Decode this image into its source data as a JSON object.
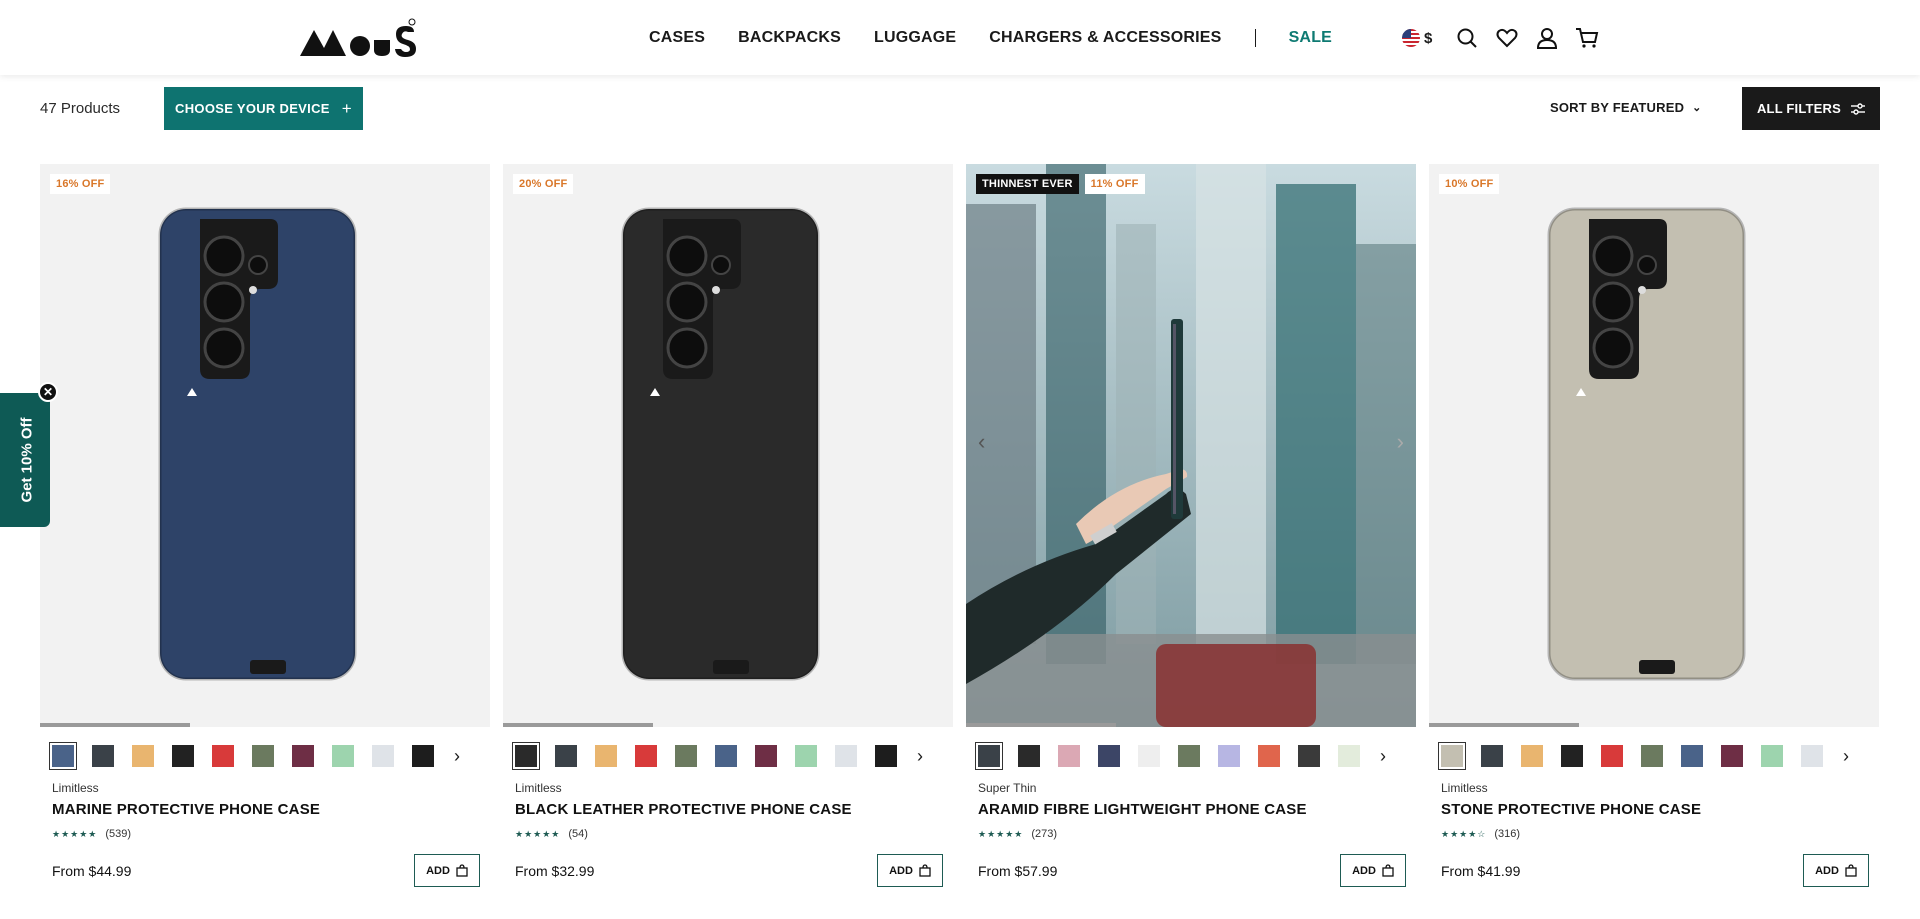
{
  "header": {
    "logo_text": "MOUS",
    "nav": [
      "CASES",
      "BACKPACKS",
      "LUGGAGE",
      "CHARGERS & ACCESSORIES"
    ],
    "sale_label": "SALE",
    "currency": "$",
    "icons": [
      "search-icon",
      "heart-icon",
      "account-icon",
      "cart-icon"
    ]
  },
  "toolbar": {
    "product_count": "47 Products",
    "choose_device": "CHOOSE YOUR DEVICE",
    "sort": "SORT BY FEATURED",
    "filters": "ALL FILTERS"
  },
  "promo": {
    "label": "Get 10% Off"
  },
  "products": [
    {
      "badges": [
        "16% OFF"
      ],
      "collection": "Limitless",
      "title": "MARINE PROTECTIVE PHONE CASE",
      "stars": "★★★★★",
      "reviews": "(539)",
      "price": "From $44.99",
      "add": "ADD",
      "case_color": "#2e4368",
      "swatches": [
        "#4a6389",
        "#3a4148",
        "#e9b56f",
        "#222222",
        "#d83a3a",
        "#6b7a5f",
        "#6e2e45",
        "#9dd4ae",
        "#dfe3e8",
        "#1d1d1d"
      ]
    },
    {
      "badges": [
        "20% OFF"
      ],
      "collection": "Limitless",
      "title": "BLACK LEATHER PROTECTIVE PHONE CASE",
      "stars": "★★★★★",
      "reviews": "(54)",
      "price": "From $32.99",
      "add": "ADD",
      "case_color": "#2a2a2a",
      "swatches": [
        "#2a2a2a",
        "#3a4148",
        "#e9b56f",
        "#d83a3a",
        "#6b7a5f",
        "#4a6389",
        "#6e2e45",
        "#9dd4ae",
        "#dfe3e8",
        "#1d1d1d"
      ]
    },
    {
      "badges": [
        "THINNEST EVER",
        "11% OFF"
      ],
      "collection": "Super Thin",
      "title": "ARAMID FIBRE LIGHTWEIGHT PHONE CASE",
      "stars": "★★★★★",
      "reviews": "(273)",
      "price": "From $57.99",
      "add": "ADD",
      "case_color": "#1f3a3a",
      "swatches": [
        "#3a4148",
        "#2a2a2a",
        "#dba8b4",
        "#3c4566",
        "#eeeeee",
        "#6b7a5f",
        "#b7b6e3",
        "#e0654c",
        "#3a3a3a",
        "#e3ecdc"
      ]
    },
    {
      "badges": [
        "10% OFF"
      ],
      "collection": "Limitless",
      "title": "STONE PROTECTIVE PHONE CASE",
      "stars": "★★★★☆",
      "reviews": "(316)",
      "price": "From $41.99",
      "add": "ADD",
      "case_color": "#c3bfb1",
      "swatches": [
        "#c3bfb1",
        "#3a4148",
        "#e9b56f",
        "#222222",
        "#d83a3a",
        "#6b7a5f",
        "#4a6389",
        "#6e2e45",
        "#9dd4ae",
        "#dfe3e8"
      ]
    }
  ]
}
